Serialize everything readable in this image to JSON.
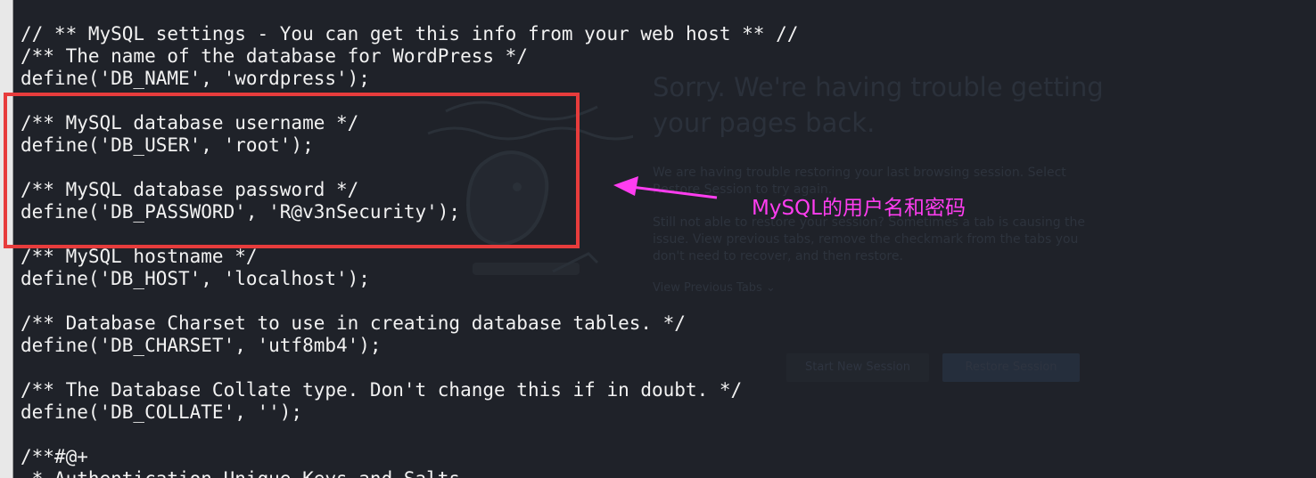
{
  "code_lines": [
    "// ** MySQL settings - You can get this info from your web host ** //",
    "/** The name of the database for WordPress */",
    "define('DB_NAME', 'wordpress');",
    "",
    "/** MySQL database username */",
    "define('DB_USER', 'root');",
    "",
    "/** MySQL database password */",
    "define('DB_PASSWORD', 'R@v3nSecurity');",
    "",
    "/** MySQL hostname */",
    "define('DB_HOST', 'localhost');",
    "",
    "/** Database Charset to use in creating database tables. */",
    "define('DB_CHARSET', 'utf8mb4');",
    "",
    "/** The Database Collate type. Don't change this if in doubt. */",
    "define('DB_COLLATE', '');",
    "",
    "/**#@+",
    " * Authentication Unique Keys and Salts."
  ],
  "annotation": {
    "text": "MySQL的用户名和密码",
    "color": "#ff3df0",
    "box_color": "#e73c3c"
  },
  "background_page": {
    "title": "Sorry. We're having trouble getting your pages back.",
    "paragraph1": "We are having trouble restoring your last browsing session. Select Restore Session to try again.",
    "paragraph2": "Still not able to restore your session? Sometimes a tab is causing the issue. View previous tabs, remove the checkmark from the tabs you don't need to recover, and then restore.",
    "view_tabs_label": "View Previous Tabs",
    "start_button": "Start New Session",
    "restore_button": "Restore Session"
  },
  "colors": {
    "background": "#1f2229",
    "code_text": "#f2f2f2"
  }
}
